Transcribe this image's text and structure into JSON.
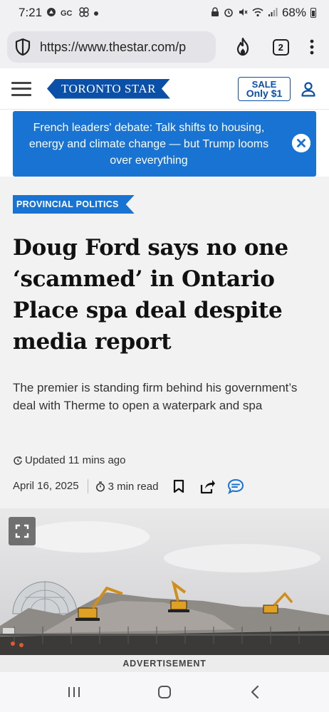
{
  "status_bar": {
    "time": "7:21",
    "left_icons": [
      "status-app-icon",
      "gc-icon",
      "pinwheel-icon",
      "dot-icon"
    ],
    "right_icons": [
      "lock-icon",
      "alarm-icon",
      "mute-icon",
      "wifi-icon",
      "signal-icon"
    ],
    "battery": "68%"
  },
  "browser": {
    "url": "https://www.thestar.com/p",
    "tab_count": "2",
    "icons": {
      "shield": "shield-icon",
      "fire": "fire-icon",
      "menu": "more-vert-icon"
    }
  },
  "site_header": {
    "logo": "TORONTO STAR",
    "sale_line1": "SALE",
    "sale_line2": "Only $1"
  },
  "banner": {
    "text": "French leaders' debate: Talk shifts to housing, energy and climate change — but Trump looms over everything"
  },
  "article": {
    "section": "PROVINCIAL POLITICS",
    "headline": "Doug Ford says no one ‘scammed’ in Ontario Place spa deal despite media report",
    "subhead": "The premier is standing firm behind his government’s deal with Therme to open a waterpark and spa",
    "updated": "Updated 11 mins ago",
    "date": "April 16, 2025",
    "read_time": "3 min read"
  },
  "advertisement_label": "ADVERTISEMENT",
  "colors": {
    "brand_blue": "#0a4fa8",
    "banner_blue": "#1873d3",
    "article_bg": "#f2f2f2"
  }
}
